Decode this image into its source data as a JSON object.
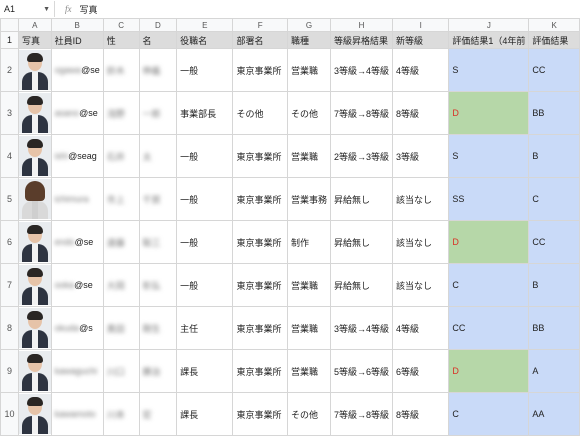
{
  "formula_bar": {
    "cell_ref": "A1",
    "fx_icon": "fx-icon",
    "value": "写真"
  },
  "columns": [
    "A",
    "B",
    "C",
    "D",
    "E",
    "F",
    "G",
    "H",
    "I",
    "J",
    "K"
  ],
  "headers": [
    "写真",
    "社員ID",
    "性",
    "名",
    "役職名",
    "部署名",
    "職種",
    "等級昇格結果",
    "新等級",
    "評価結果1（4年前",
    "評価結果"
  ],
  "rows": [
    {
      "num": "2",
      "photo": "avatar-male",
      "id": "ogawa",
      "domain": "@se",
      "sei": "鈴木",
      "mei": "伸義",
      "title": "一般",
      "dept": "東京事業所",
      "job": "営業職",
      "grade_result": "3等級→4等級",
      "new_grade": "4等級",
      "eval1": "S",
      "eval2": "CC",
      "eval1_bg": "blue",
      "eval1_red": false
    },
    {
      "num": "3",
      "photo": "avatar-male",
      "id": "asano",
      "domain": "@se",
      "sei": "浅野",
      "mei": "一郎",
      "title": "事業部長",
      "dept": "その他",
      "job": "その他",
      "grade_result": "7等級→8等級",
      "new_grade": "8等級",
      "eval1": "D",
      "eval2": "BB",
      "eval1_bg": "green",
      "eval1_red": true
    },
    {
      "num": "4",
      "photo": "avatar-male",
      "id": "ishi",
      "domain": "@seag",
      "sei": "石井",
      "mei": "太",
      "title": "一般",
      "dept": "東京事業所",
      "job": "営業職",
      "grade_result": "2等級→3等級",
      "new_grade": "3等級",
      "eval1": "S",
      "eval2": "B",
      "eval1_bg": "blue",
      "eval1_red": false
    },
    {
      "num": "5",
      "photo": "avatar-female",
      "id": "ichimura",
      "domain": "",
      "sei": "市上",
      "mei": "千賀",
      "title": "一般",
      "dept": "東京事業所",
      "job": "営業事務",
      "grade_result": "昇給無し",
      "new_grade": "該当なし",
      "eval1": "SS",
      "eval2": "C",
      "eval1_bg": "blue",
      "eval1_red": false
    },
    {
      "num": "6",
      "photo": "avatar-male",
      "id": "endo",
      "domain": "@se",
      "sei": "遠藤",
      "mei": "聡三",
      "title": "一般",
      "dept": "東京事業所",
      "job": "制作",
      "grade_result": "昇給無し",
      "new_grade": "該当なし",
      "eval1": "D",
      "eval2": "CC",
      "eval1_bg": "green",
      "eval1_red": true
    },
    {
      "num": "7",
      "photo": "avatar-male",
      "id": "ooka",
      "domain": "@se",
      "sei": "大岡",
      "mei": "彰弘",
      "title": "一般",
      "dept": "東京事業所",
      "job": "営業職",
      "grade_result": "昇給無し",
      "new_grade": "該当なし",
      "eval1": "C",
      "eval2": "B",
      "eval1_bg": "blue",
      "eval1_red": false
    },
    {
      "num": "8",
      "photo": "avatar-male",
      "id": "okuda",
      "domain": "@s",
      "sei": "奥田",
      "mei": "剛生",
      "title": "主任",
      "dept": "東京事業所",
      "job": "営業職",
      "grade_result": "3等級→4等級",
      "new_grade": "4等級",
      "eval1": "CC",
      "eval2": "BB",
      "eval1_bg": "blue",
      "eval1_red": false
    },
    {
      "num": "9",
      "photo": "avatar-male",
      "id": "kawaguchi",
      "domain": "",
      "sei": "川口",
      "mei": "勝治",
      "title": "課長",
      "dept": "東京事業所",
      "job": "営業職",
      "grade_result": "5等級→6等級",
      "new_grade": "6等級",
      "eval1": "D",
      "eval2": "A",
      "eval1_bg": "green",
      "eval1_red": true
    },
    {
      "num": "10",
      "photo": "avatar-male",
      "id": "kawamoto",
      "domain": "",
      "sei": "川本",
      "mei": "宏",
      "title": "課長",
      "dept": "東京事業所",
      "job": "その他",
      "grade_result": "7等級→8等級",
      "new_grade": "8等級",
      "eval1": "C",
      "eval2": "AA",
      "eval1_bg": "blue",
      "eval1_red": false
    }
  ]
}
